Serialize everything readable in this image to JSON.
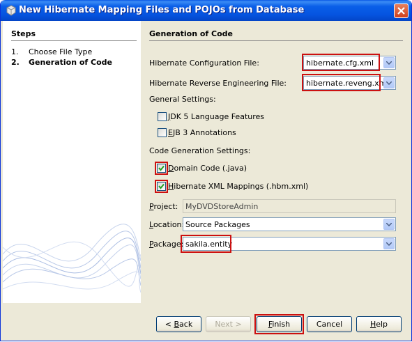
{
  "window": {
    "title": "New Hibernate Mapping Files and POJOs from Database"
  },
  "steps": {
    "heading": "Steps",
    "items": [
      {
        "num": "1.",
        "label": "Choose File Type"
      },
      {
        "num": "2.",
        "label": "Generation of Code"
      }
    ]
  },
  "panel": {
    "heading": "Generation of Code",
    "config_file": {
      "label": "Hibernate Configuration File:",
      "value": "hibernate.cfg.xml"
    },
    "reveng_file": {
      "label": "Hibernate Reverse Engineering File:",
      "value": "hibernate.reveng.xml"
    },
    "general_settings": {
      "label": "General Settings:",
      "jdk5": {
        "mnemonic": "J",
        "rest": "DK 5 Language Features",
        "checked": false
      },
      "ejb3": {
        "mnemonic": "E",
        "rest": "JB 3 Annotations",
        "checked": false
      }
    },
    "code_gen": {
      "label": "Code Generation Settings:",
      "domain": {
        "mnemonic": "D",
        "rest": "omain Code (.java)",
        "checked": true
      },
      "hbm": {
        "mnemonic": "H",
        "rest": "ibernate XML Mappings (.hbm.xml)",
        "checked": true
      }
    },
    "project": {
      "mnemonic": "P",
      "rest": "roject:",
      "value": "MyDVDStoreAdmin"
    },
    "location": {
      "mnemonic": "L",
      "rest": "ocation:",
      "value": "Source Packages"
    },
    "package": {
      "mnemonic": "P",
      "rest": "ackage:",
      "value": "sakila.entity"
    }
  },
  "buttons": {
    "back": {
      "prefix": "< ",
      "mnemonic": "B",
      "rest": "ack"
    },
    "next": "Next >",
    "finish": {
      "mnemonic": "F",
      "rest": "inish"
    },
    "cancel": "Cancel",
    "help": {
      "mnemonic": "H",
      "rest": "elp"
    }
  },
  "colors": {
    "highlight": "#cc1010",
    "titlebar": "#0a5fe8",
    "check": "#21a121"
  }
}
